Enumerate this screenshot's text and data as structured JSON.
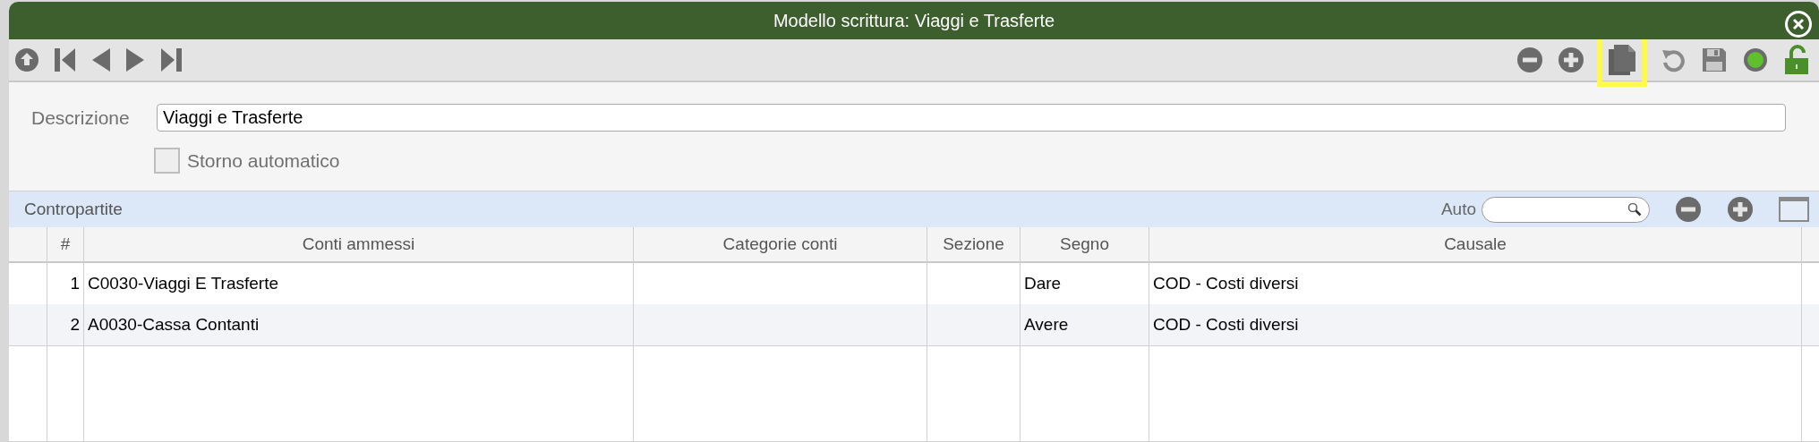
{
  "window": {
    "title": "Modello scrittura: Viaggi e Trasferte"
  },
  "toolbar_left": [
    {
      "kind": "up"
    },
    {
      "kind": "first"
    },
    {
      "kind": "prev"
    },
    {
      "kind": "next"
    },
    {
      "kind": "last"
    }
  ],
  "toolbar_right": [
    {
      "kind": "minus",
      "highlighted": false
    },
    {
      "kind": "plus",
      "highlighted": false
    },
    {
      "kind": "copy",
      "highlighted": true
    },
    {
      "kind": "undo",
      "highlighted": false
    },
    {
      "kind": "save",
      "highlighted": false
    },
    {
      "kind": "status",
      "highlighted": false
    },
    {
      "kind": "lock",
      "highlighted": false
    }
  ],
  "form": {
    "description_label": "Descrizione",
    "description_value": "Viaggi e Trasferte",
    "storno_label": "Storno automatico",
    "storno_checked": false
  },
  "section": {
    "title": "Contropartite",
    "search_label": "Auto"
  },
  "table": {
    "columns": [
      "#",
      "Conti ammessi",
      "Categorie conti",
      "Sezione",
      "Segno",
      "Causale"
    ],
    "rows": [
      {
        "cells": [
          "1",
          "C0030-Viaggi E Trasferte",
          "",
          "",
          "Dare",
          "COD - Costi diversi"
        ]
      },
      {
        "cells": [
          "2",
          "A0030-Cassa Contanti",
          "",
          "",
          "Avere",
          "COD - Costi diversi"
        ]
      }
    ]
  }
}
